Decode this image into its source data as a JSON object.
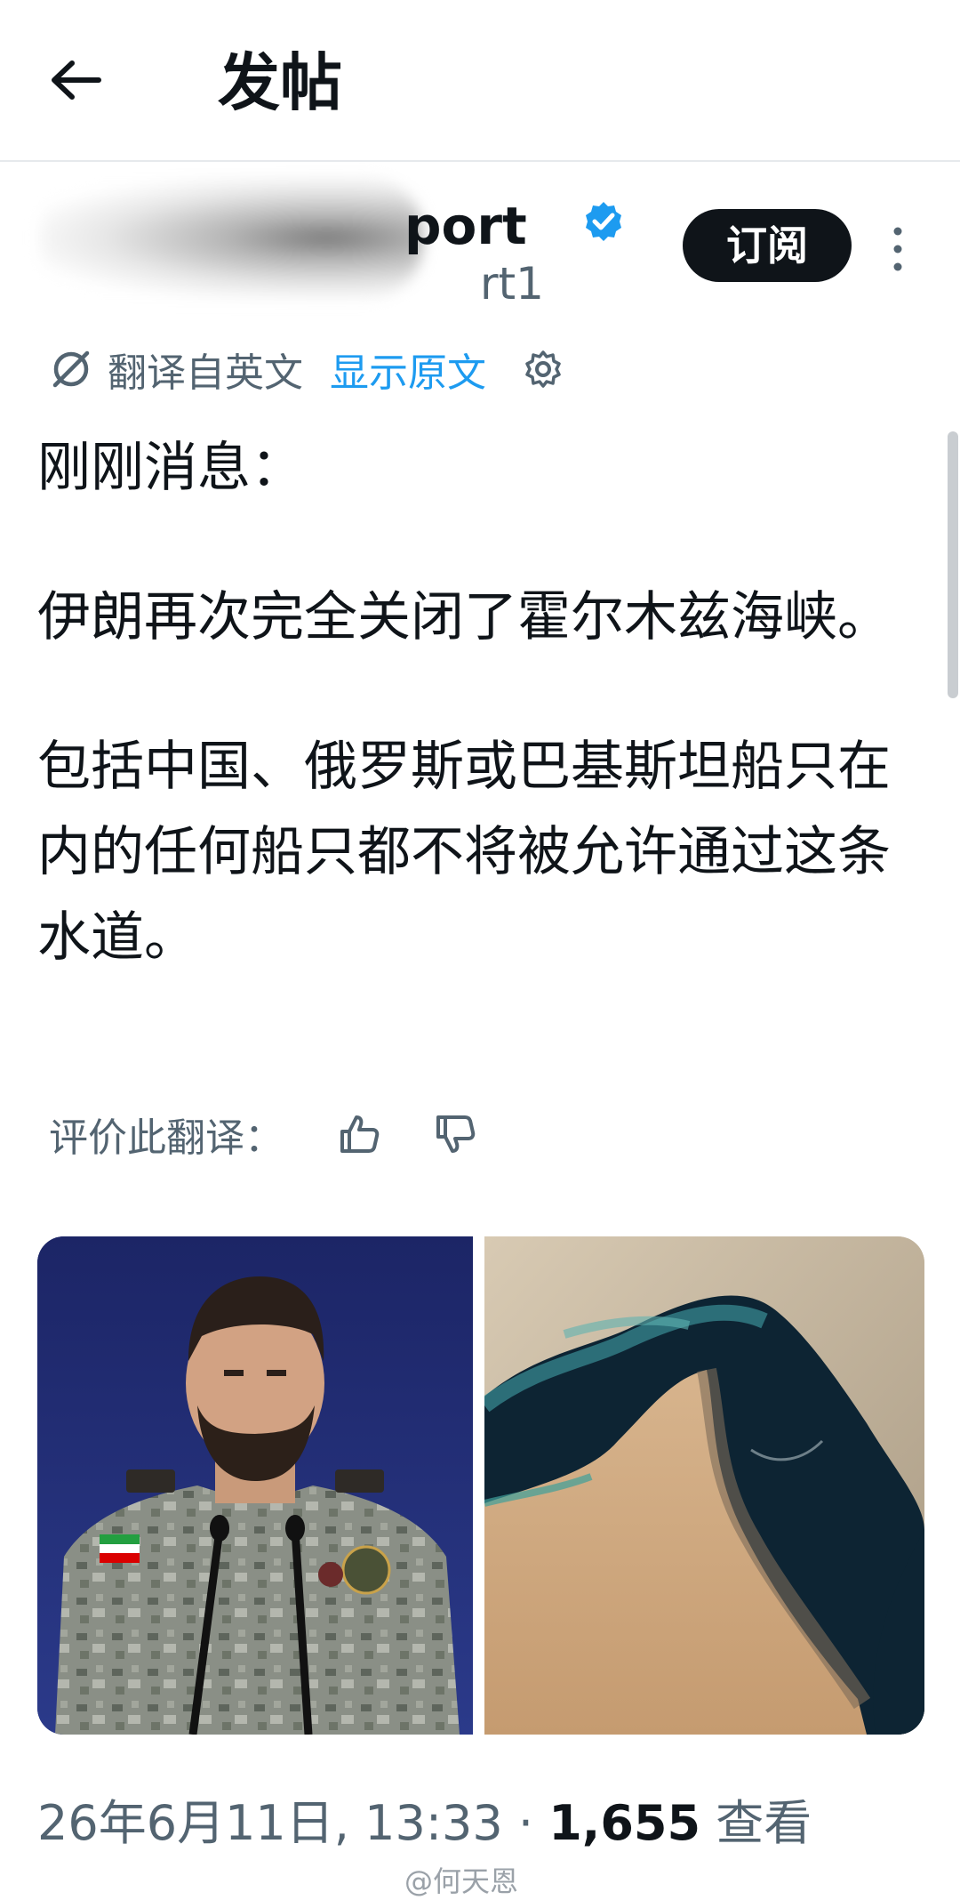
{
  "header": {
    "back_icon": "arrow-left-icon",
    "title": "发帖"
  },
  "author": {
    "name_visible": "port",
    "handle_visible": "rt1",
    "verified_icon": "verified-badge-icon",
    "verified_color": "#1d9bf0",
    "subscribe_label": "订阅",
    "more_icon": "more-vertical-icon"
  },
  "translation": {
    "icon": "translate-icon",
    "label": "翻译自英文",
    "show_original": "显示原文",
    "settings_icon": "gear-icon"
  },
  "post": {
    "paragraphs": [
      "刚刚消息：",
      "伊朗再次完全关闭了霍尔木兹海峡。",
      "包括中国、俄罗斯或巴基斯坦船只在内的任何船只都不将被允许通过这条水道。"
    ]
  },
  "rate": {
    "label": "评价此翻译：",
    "like_icon": "thumbs-up-icon",
    "dislike_icon": "thumbs-down-icon"
  },
  "media": {
    "left_desc": "military-spokesperson-photo",
    "right_desc": "satellite-map-strait-of-hormuz"
  },
  "meta": {
    "timestamp": "26年6月11日, 13:33",
    "separator": " · ",
    "views_count": "1,655",
    "views_label": "查看"
  },
  "watermark": "@何天恩",
  "colors": {
    "accent": "#1d9bf0",
    "text_primary": "#0f1419",
    "text_secondary": "#536471"
  }
}
